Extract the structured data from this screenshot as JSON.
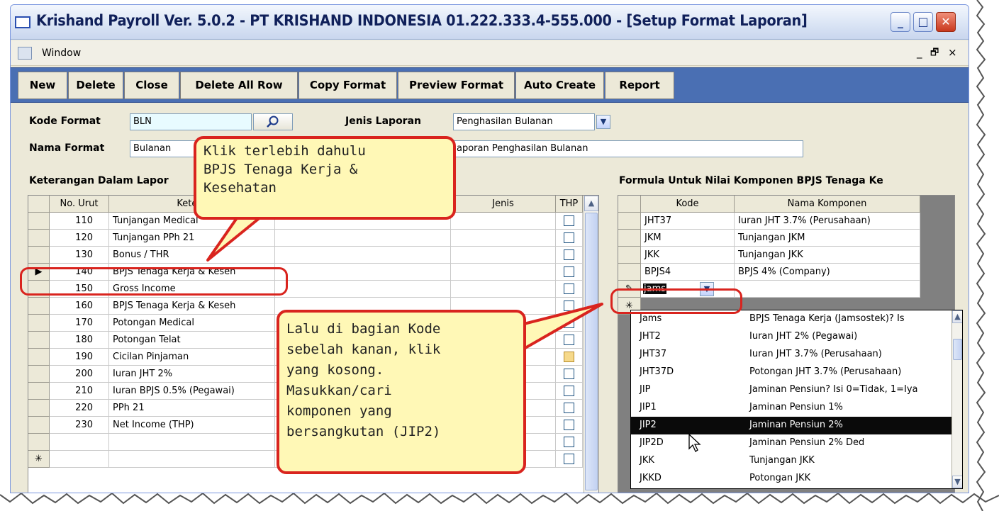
{
  "window": {
    "title": "Krishand Payroll Ver. 5.0.2 - PT KRISHAND INDONESIA 01.222.333.4-555.000 - [Setup Format Laporan]",
    "minimize": "_",
    "maximize": "□",
    "close": "✕"
  },
  "menubar": {
    "window_label": "Window",
    "mdi_minimize": "_",
    "mdi_restore": "🗗",
    "mdi_close": "×"
  },
  "toolbar": {
    "new": "New",
    "delete": "Delete",
    "close": "Close",
    "delete_all_row": "Delete All Row",
    "copy_format": "Copy Format",
    "preview_format": "Preview Format",
    "auto_create": "Auto Create",
    "report": "Report"
  },
  "form": {
    "kode_format_label": "Kode Format",
    "kode_format_value": "BLN",
    "jenis_laporan_label": "Jenis Laporan",
    "jenis_laporan_value": "Penghasilan Bulanan",
    "nama_format_label": "Nama Format",
    "nama_format_value": "Bulanan",
    "judul_value": "aporan Penghasilan Bulanan"
  },
  "left_grid": {
    "title": "Keterangan Dalam Lapor",
    "headers": [
      "No. Urut",
      "Ketera",
      "",
      "Jenis",
      "THP"
    ],
    "rows": [
      {
        "no": "110",
        "ket": "Tunjangan Medical"
      },
      {
        "no": "120",
        "ket": "Tunjangan PPh 21"
      },
      {
        "no": "130",
        "ket": "Bonus / THR"
      },
      {
        "no": "140",
        "ket": "BPJS Tenaga Kerja & Keseh"
      },
      {
        "no": "150",
        "ket": "Gross Income"
      },
      {
        "no": "160",
        "ket": "BPJS Tenaga Kerja & Keseh"
      },
      {
        "no": "170",
        "ket": "Potongan Medical"
      },
      {
        "no": "180",
        "ket": "Potongan Telat"
      },
      {
        "no": "190",
        "ket": "Cicilan Pinjaman"
      },
      {
        "no": "200",
        "ket": "Iuran JHT 2%"
      },
      {
        "no": "210",
        "ket": "Iuran BPJS 0.5% (Pegawai)"
      },
      {
        "no": "220",
        "ket": "PPh 21"
      },
      {
        "no": "230",
        "ket": "Net Income (THP)"
      }
    ],
    "current_row_marker": "▶",
    "new_row_marker": "✳"
  },
  "right_grid": {
    "title": "Formula Untuk Nilai Komponen BPJS Tenaga Ke",
    "headers": [
      "Kode",
      "Nama Komponen"
    ],
    "rows": [
      {
        "kode": "JHT37",
        "nama": "Iuran JHT 3.7% (Perusahaan)"
      },
      {
        "kode": "JKM",
        "nama": "Tunjangan JKM"
      },
      {
        "kode": "JKK",
        "nama": "Tunjangan JKK"
      },
      {
        "kode": "BPJS4",
        "nama": "BPJS 4% (Company)"
      }
    ],
    "edit_value": "jams",
    "edit_marker": "✎",
    "new_row_marker": "✳"
  },
  "dropdown": {
    "items": [
      {
        "kode": "Jams",
        "nama": "BPJS Tenaga Kerja (Jamsostek)? Is"
      },
      {
        "kode": "JHT2",
        "nama": "Iuran JHT 2% (Pegawai)"
      },
      {
        "kode": "JHT37",
        "nama": "Iuran JHT 3.7% (Perusahaan)"
      },
      {
        "kode": "JHT37D",
        "nama": "Potongan JHT 3.7% (Perusahaan)"
      },
      {
        "kode": "JIP",
        "nama": "Jaminan Pensiun? Isi 0=Tidak, 1=Iya"
      },
      {
        "kode": "JIP1",
        "nama": "Jaminan Pensiun 1%"
      },
      {
        "kode": "JIP2",
        "nama": "Jaminan Pensiun 2%"
      },
      {
        "kode": "JIP2D",
        "nama": "Jaminan Pensiun 2% Ded"
      },
      {
        "kode": "JKK",
        "nama": "Tunjangan JKK"
      },
      {
        "kode": "JKKD",
        "nama": "Potongan JKK"
      }
    ],
    "selected_kode": "JIP2"
  },
  "callouts": {
    "top": [
      "Klik terlebih dahulu",
      "BPJS Tenaga Kerja &",
      "Kesehatan"
    ],
    "bottom": [
      "Lalu di bagian Kode",
      "sebelah kanan, klik",
      "yang kosong.",
      "Masukkan/cari",
      "komponen yang",
      "bersangkutan (JIP2)"
    ]
  },
  "colors": {
    "toolbar_bg": "#4a6fb3",
    "callout_fill": "#fff8b6",
    "callout_border": "#d9241e",
    "highlight_row": "#0a0a0a"
  }
}
